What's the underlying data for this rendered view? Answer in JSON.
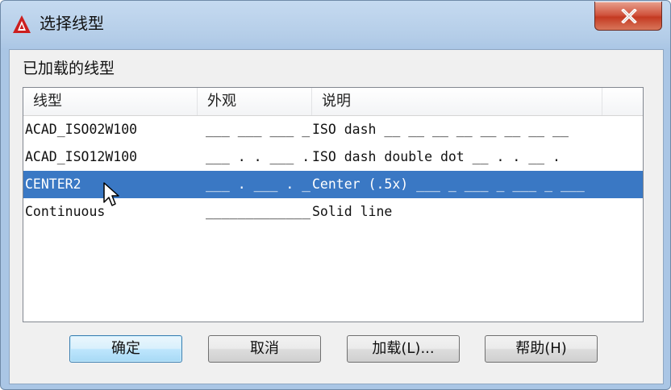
{
  "window": {
    "title": "选择线型",
    "icon": "autocad-logo-icon",
    "close_icon": "close-x-icon"
  },
  "group_label": "已加载的线型",
  "list": {
    "columns": [
      "线型",
      "外观",
      "说明"
    ],
    "rows": [
      {
        "name": "ACAD_ISO02W100",
        "appearance": "___ ___ ___ _",
        "description": "ISO dash __ __ __ __ __ __ __ __",
        "selected": false
      },
      {
        "name": "ACAD_ISO12W100",
        "appearance": "___ . . ___ . . _",
        "description": "ISO dash double dot __ . . __ .",
        "selected": false
      },
      {
        "name": "CENTER2",
        "appearance": "___ . ___ . ___ .",
        "description": "Center (.5x) ___ _ ___ _ ___ _ ___",
        "selected": true
      },
      {
        "name": "Continuous",
        "appearance": "______________",
        "description": "Solid line",
        "selected": false
      }
    ]
  },
  "buttons": {
    "ok": "确定",
    "cancel": "取消",
    "load": "加载(L)...",
    "help": "帮助(H)"
  },
  "colors": {
    "selection": "#3a78c4",
    "brand_red": "#cc1f1f"
  }
}
